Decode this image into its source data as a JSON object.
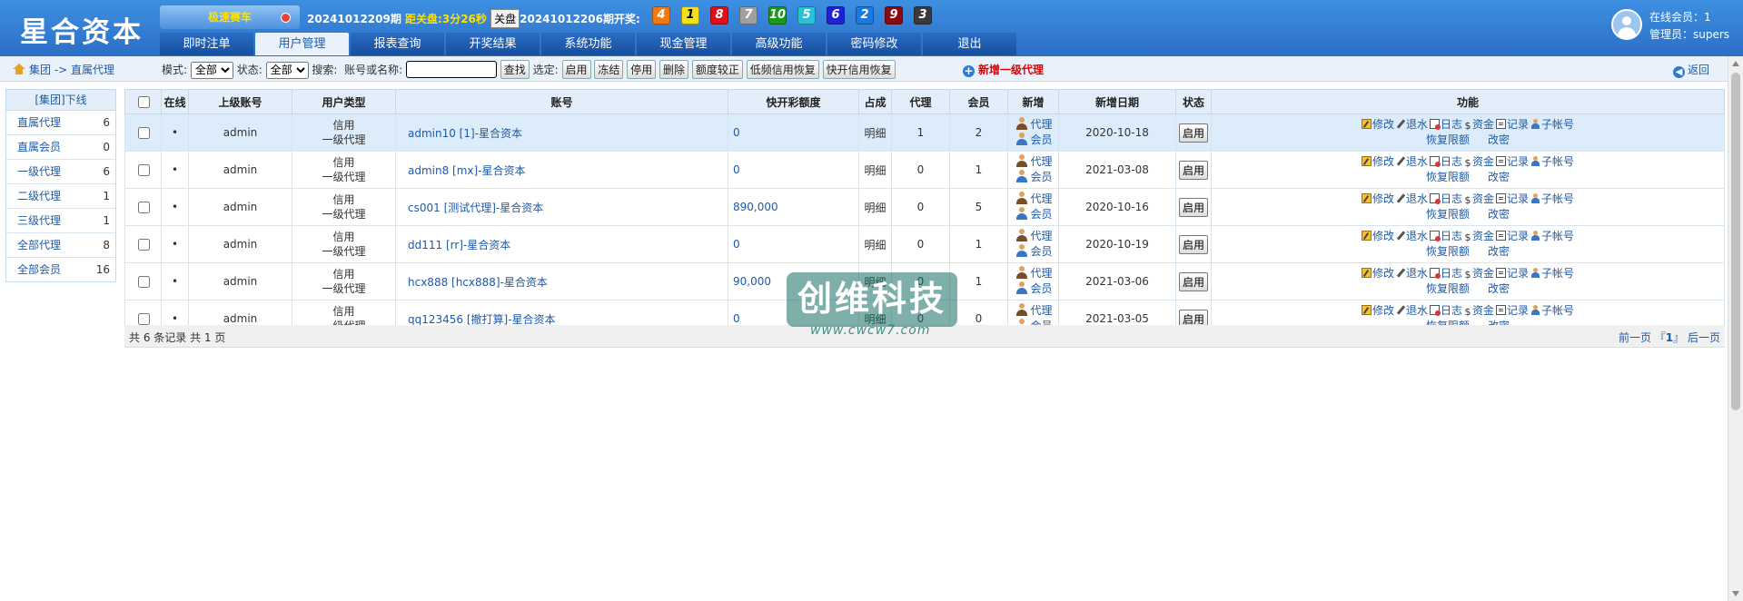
{
  "header": {
    "logo": "星合资本",
    "game_button": "极速赛车",
    "draw": {
      "period": "20241012209期",
      "close_label": "距关盘:",
      "countdown": "3分26秒",
      "close_button": "关盘",
      "last_period": "20241012206期开奖:",
      "balls": [
        {
          "n": "4",
          "color": "#f07a10"
        },
        {
          "n": "1",
          "color": "#f2e21c"
        },
        {
          "n": "8",
          "color": "#e0101a"
        },
        {
          "n": "7",
          "color": "#a0a0a0"
        },
        {
          "n": "10",
          "color": "#1a9a1a"
        },
        {
          "n": "5",
          "color": "#27c2d8"
        },
        {
          "n": "6",
          "color": "#2020d8"
        },
        {
          "n": "2",
          "color": "#1a7ae0"
        },
        {
          "n": "9",
          "color": "#8a0a14"
        },
        {
          "n": "3",
          "color": "#3a3a3a"
        }
      ]
    },
    "nav": [
      "即时注单",
      "用户管理",
      "报表查询",
      "开奖结果",
      "系统功能",
      "现金管理",
      "高级功能",
      "密码修改",
      "退出"
    ],
    "nav_active": 1,
    "online_label": "在线会员：1",
    "admin_label": "管理员：supers"
  },
  "toolbar": {
    "breadcrumb": "集团 -> 直属代理",
    "mode_label": "模式:",
    "mode_value": "全部",
    "status_label": "状态:",
    "status_value": "全部",
    "search_label": "搜索:",
    "account_label": "账号或名称:",
    "search_input": "",
    "find_button": "查找",
    "select_label": "选定:",
    "actions": [
      "启用",
      "冻结",
      "停用",
      "删除",
      "额度较正",
      "低频信用恢复",
      "快开信用恢复"
    ],
    "new_agent": "新增一级代理",
    "back": "返回"
  },
  "sidebar": {
    "header": "[集团]下线",
    "items": [
      {
        "label": "直属代理",
        "count": "6"
      },
      {
        "label": "直属会员",
        "count": "0"
      },
      {
        "label": "一级代理",
        "count": "6"
      },
      {
        "label": "二级代理",
        "count": "1"
      },
      {
        "label": "三级代理",
        "count": "1"
      },
      {
        "label": "全部代理",
        "count": "8"
      },
      {
        "label": "全部会员",
        "count": "16"
      }
    ]
  },
  "table": {
    "columns": [
      "在线",
      "上级账号",
      "用户类型",
      "账号",
      "快开彩额度",
      "占成",
      "代理",
      "会员",
      "新增",
      "状态",
      "功能"
    ],
    "rows": [
      {
        "online": "•",
        "parent": "admin",
        "type1": "信用",
        "type2": "一级代理",
        "account": "admin10 [1]-星合资本",
        "quota": "0",
        "share": "明细",
        "agents": "1",
        "members": "2",
        "new_agent": "代理",
        "new_member": "会员",
        "date": "2020-10-18",
        "status": "启用"
      },
      {
        "online": "•",
        "parent": "admin",
        "type1": "信用",
        "type2": "一级代理",
        "account": "admin8 [mx]-星合资本",
        "quota": "0",
        "share": "明细",
        "agents": "0",
        "members": "1",
        "new_agent": "代理",
        "new_member": "会员",
        "date": "2021-03-08",
        "status": "启用"
      },
      {
        "online": "•",
        "parent": "admin",
        "type1": "信用",
        "type2": "一级代理",
        "account": "cs001 [测试代理]-星合资本",
        "quota": "890,000",
        "share": "明细",
        "agents": "0",
        "members": "5",
        "new_agent": "代理",
        "new_member": "会员",
        "date": "2020-10-16",
        "status": "启用"
      },
      {
        "online": "•",
        "parent": "admin",
        "type1": "信用",
        "type2": "一级代理",
        "account": "dd111 [rr]-星合资本",
        "quota": "0",
        "share": "明细",
        "agents": "0",
        "members": "1",
        "new_agent": "代理",
        "new_member": "会员",
        "date": "2020-10-19",
        "status": "启用"
      },
      {
        "online": "•",
        "parent": "admin",
        "type1": "信用",
        "type2": "一级代理",
        "account": "hcx888 [hcx888]-星合资本",
        "quota": "90,000",
        "share": "明细",
        "agents": "0",
        "members": "1",
        "new_agent": "代理",
        "new_member": "会员",
        "date": "2021-03-06",
        "status": "启用"
      },
      {
        "online": "•",
        "parent": "admin",
        "type1": "信用",
        "type2": "一级代理",
        "account": "qq123456 [撤打算]-星合资本",
        "quota": "0",
        "share": "明细",
        "agents": "0",
        "members": "0",
        "new_agent": "代理",
        "new_member": "会员",
        "date": "2021-03-05",
        "status": "启用"
      }
    ],
    "funcs_line1": [
      "修改",
      "退水",
      "日志",
      "资金",
      "记录",
      "子帐号"
    ],
    "funcs_line2": [
      "恢复限额",
      "改密"
    ],
    "new_col_date_header": "新增日期"
  },
  "footer": {
    "summary": "共 6 条记录 共 1 页",
    "prev": "前一页",
    "page": "1",
    "next": "后一页"
  },
  "watermark": {
    "main": "创维科技",
    "sub": "www.cwcw7.com"
  }
}
